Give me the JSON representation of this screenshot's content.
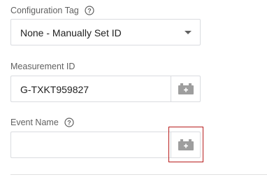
{
  "configuration_tag": {
    "label": "Configuration Tag",
    "selected_value": "None - Manually Set ID",
    "help_icon": "help-circle-icon"
  },
  "measurement_id": {
    "label": "Measurement ID",
    "value": "G-TXKT959827",
    "variable_button_icon": "lego-brick-variable-icon"
  },
  "event_name": {
    "label": "Event Name",
    "value": "",
    "help_icon": "help-circle-icon",
    "variable_button_icon": "lego-brick-variable-icon"
  },
  "colors": {
    "highlight": "#b71c1c",
    "icon_gray": "#9e9e9e",
    "border": "#dadce0"
  }
}
